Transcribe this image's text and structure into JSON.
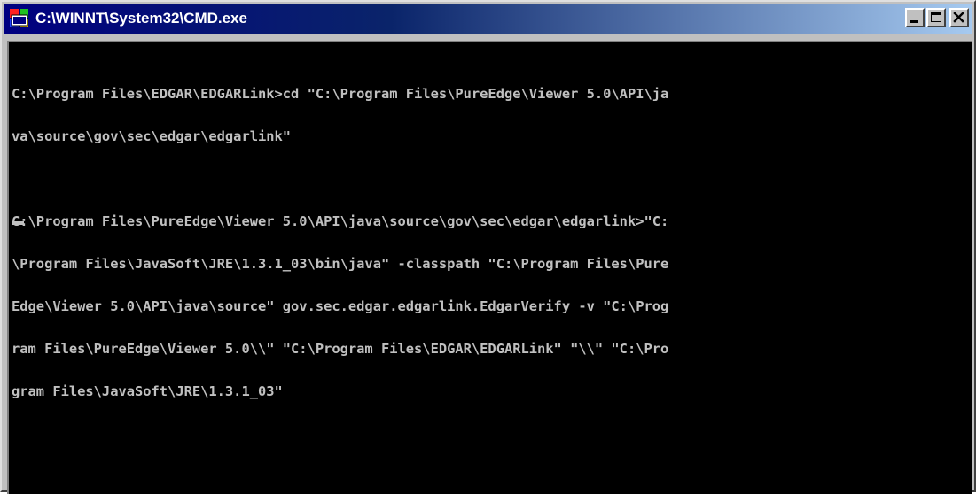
{
  "window": {
    "title": "C:\\WINNT\\System32\\CMD.exe",
    "title_icon": "msdos-icon",
    "controls": [
      "minimize-icon",
      "maximize-icon",
      "close-icon"
    ]
  },
  "console": {
    "lines": [
      "C:\\Program Files\\EDGAR\\EDGARLink>cd \"C:\\Program Files\\PureEdge\\Viewer 5.0\\API\\ja",
      "va\\source\\gov\\sec\\edgar\\edgarlink\"",
      "",
      "C:\\Program Files\\PureEdge\\Viewer 5.0\\API\\java\\source\\gov\\sec\\edgar\\edgarlink>\"C:",
      "\\Program Files\\JavaSoft\\JRE\\1.3.1_03\\bin\\java\" -classpath \"C:\\Program Files\\Pure",
      "Edge\\Viewer 5.0\\API\\java\\source\" gov.sec.edgar.edgarlink.EdgarVerify -v \"C:\\Prog",
      "ram Files\\PureEdge\\Viewer 5.0\\\\\" \"C:\\Program Files\\EDGAR\\EDGARLink\" \"\\\\\" \"C:\\Pro",
      "gram Files\\JavaSoft\\JRE\\1.3.1_03\""
    ]
  },
  "colors": {
    "title_bar": "#000080",
    "title_bar_fade": "#a6caf0",
    "console_bg": "#000000",
    "console_text": "#c0c0c0",
    "chrome": "#c0c0c0"
  }
}
